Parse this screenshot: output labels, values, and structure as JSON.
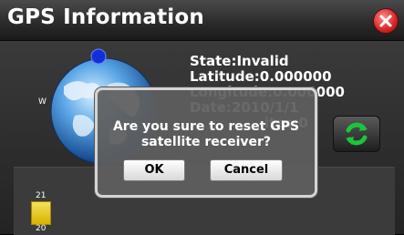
{
  "window": {
    "title": "GPS Information"
  },
  "globe": {
    "west_label": "W"
  },
  "info": {
    "state": "State:Invalid",
    "latitude": "Latitude:0.000000",
    "longitude": "Longitude:0.000000",
    "date": "Date:2010/1/1",
    "satellites_partial": "ites:0"
  },
  "signal_chart": {
    "tick_top": "21",
    "tick_bottom": "20"
  },
  "dialog": {
    "message": "Are you sure to reset GPS satellite receiver?",
    "ok_label": "OK",
    "cancel_label": "Cancel"
  },
  "icons": {
    "close": "close-icon",
    "refresh": "refresh-icon",
    "globe": "globe-icon"
  },
  "colors": {
    "close_red": "#d42424",
    "refresh_green": "#19c63a",
    "bar_yellow": "#e6c81a"
  }
}
